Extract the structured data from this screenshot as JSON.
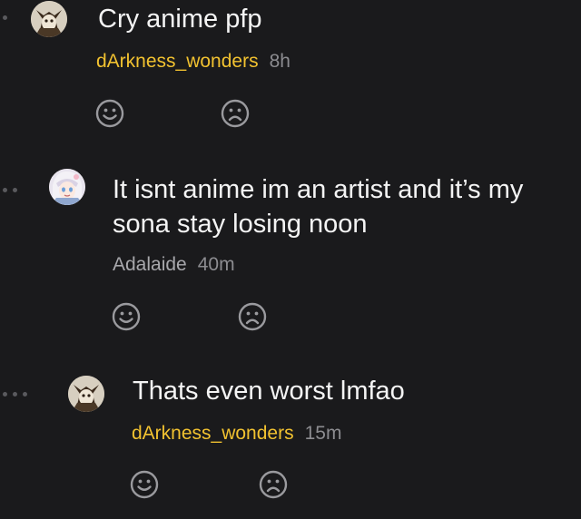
{
  "comments": [
    {
      "text_lines": [
        "Cry anime pfp"
      ],
      "author": "dArkness_wonders",
      "time": "8h",
      "author_color": "#f2c230",
      "depth": 1,
      "avatar": "horned-mask-avatar"
    },
    {
      "text_lines": [
        "It isnt anime im an artist and it’s my",
        "sona stay losing noon"
      ],
      "author": "Adalaide",
      "time": "40m",
      "author_color": "#a8a8ac",
      "depth": 2,
      "avatar": "anime-girl-avatar"
    },
    {
      "text_lines": [
        "Thats even worst lmfao"
      ],
      "author": "dArkness_wonders",
      "time": "15m",
      "author_color": "#f2c230",
      "depth": 3,
      "avatar": "horned-mask-avatar"
    }
  ],
  "reactions": {
    "like_icon": "smile-face-icon",
    "dislike_icon": "frown-face-icon"
  },
  "colors": {
    "background": "#1a1a1c",
    "text": "#f4f4f4",
    "time": "#8c8c90",
    "icon": "#9a9a9e",
    "highlight_author": "#f2c230"
  }
}
